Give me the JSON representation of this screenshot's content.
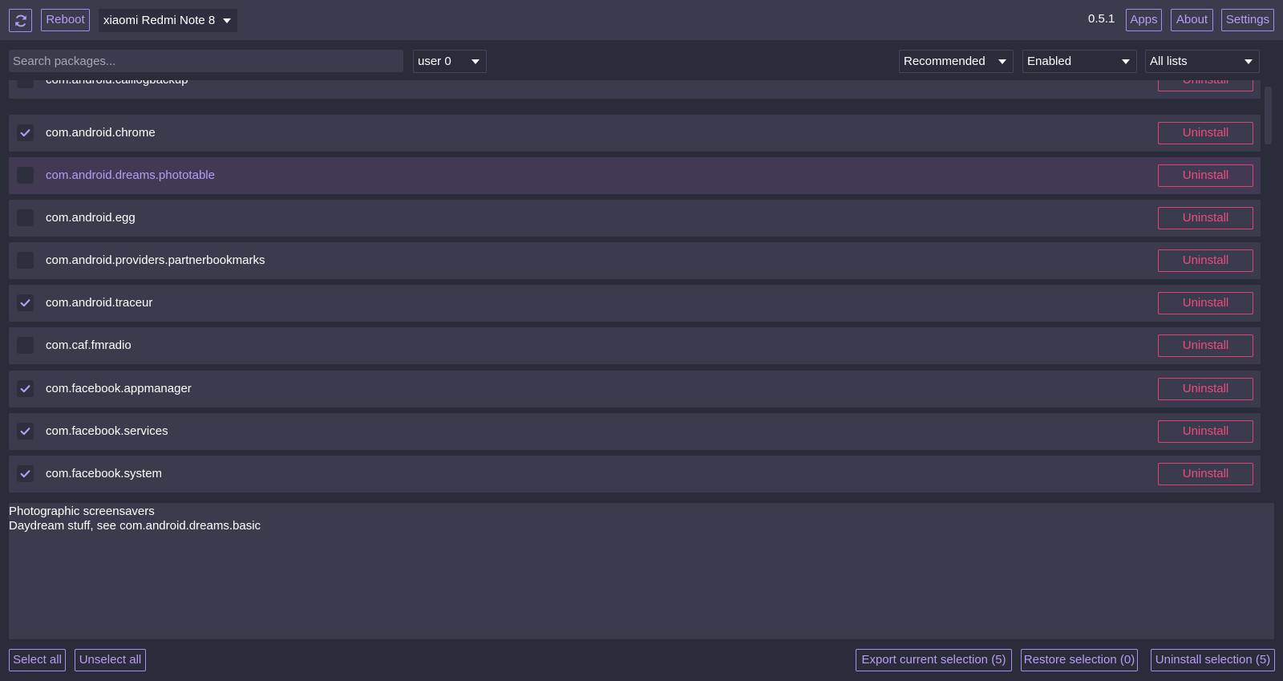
{
  "header": {
    "refresh_icon": "refresh-icon",
    "reboot_label": "Reboot",
    "device": "xiaomi Redmi Note 8",
    "version": "0.5.1",
    "apps_label": "Apps",
    "about_label": "About",
    "settings_label": "Settings"
  },
  "toolbar": {
    "search_placeholder": "Search packages...",
    "user": "user 0",
    "recommendation": "Recommended",
    "state": "Enabled",
    "list": "All lists"
  },
  "packages": [
    {
      "name": "com.android.calllogbackup",
      "checked": false,
      "action": "Uninstall"
    },
    {
      "name": "com.android.chrome",
      "checked": true,
      "action": "Uninstall"
    },
    {
      "name": "com.android.dreams.phototable",
      "checked": false,
      "action": "Uninstall",
      "highlighted": true
    },
    {
      "name": "com.android.egg",
      "checked": false,
      "action": "Uninstall"
    },
    {
      "name": "com.android.providers.partnerbookmarks",
      "checked": false,
      "action": "Uninstall"
    },
    {
      "name": "com.android.traceur",
      "checked": true,
      "action": "Uninstall"
    },
    {
      "name": "com.caf.fmradio",
      "checked": false,
      "action": "Uninstall"
    },
    {
      "name": "com.facebook.appmanager",
      "checked": true,
      "action": "Uninstall"
    },
    {
      "name": "com.facebook.services",
      "checked": true,
      "action": "Uninstall"
    },
    {
      "name": "com.facebook.system",
      "checked": true,
      "action": "Uninstall"
    }
  ],
  "description": {
    "line1": "Photographic screensavers",
    "line2": "Daydream stuff, see com.android.dreams.basic"
  },
  "footer": {
    "select_all": "Select all",
    "unselect_all": "Unselect all",
    "export": "Export current selection (5)",
    "restore": "Restore selection (0)",
    "uninstall": "Uninstall selection (5)"
  },
  "colors": {
    "background": "#2b2c3a",
    "panel": "#3a3b4c",
    "accent": "#a98af0",
    "danger": "#e0436f",
    "selected_row": "#423a54"
  }
}
